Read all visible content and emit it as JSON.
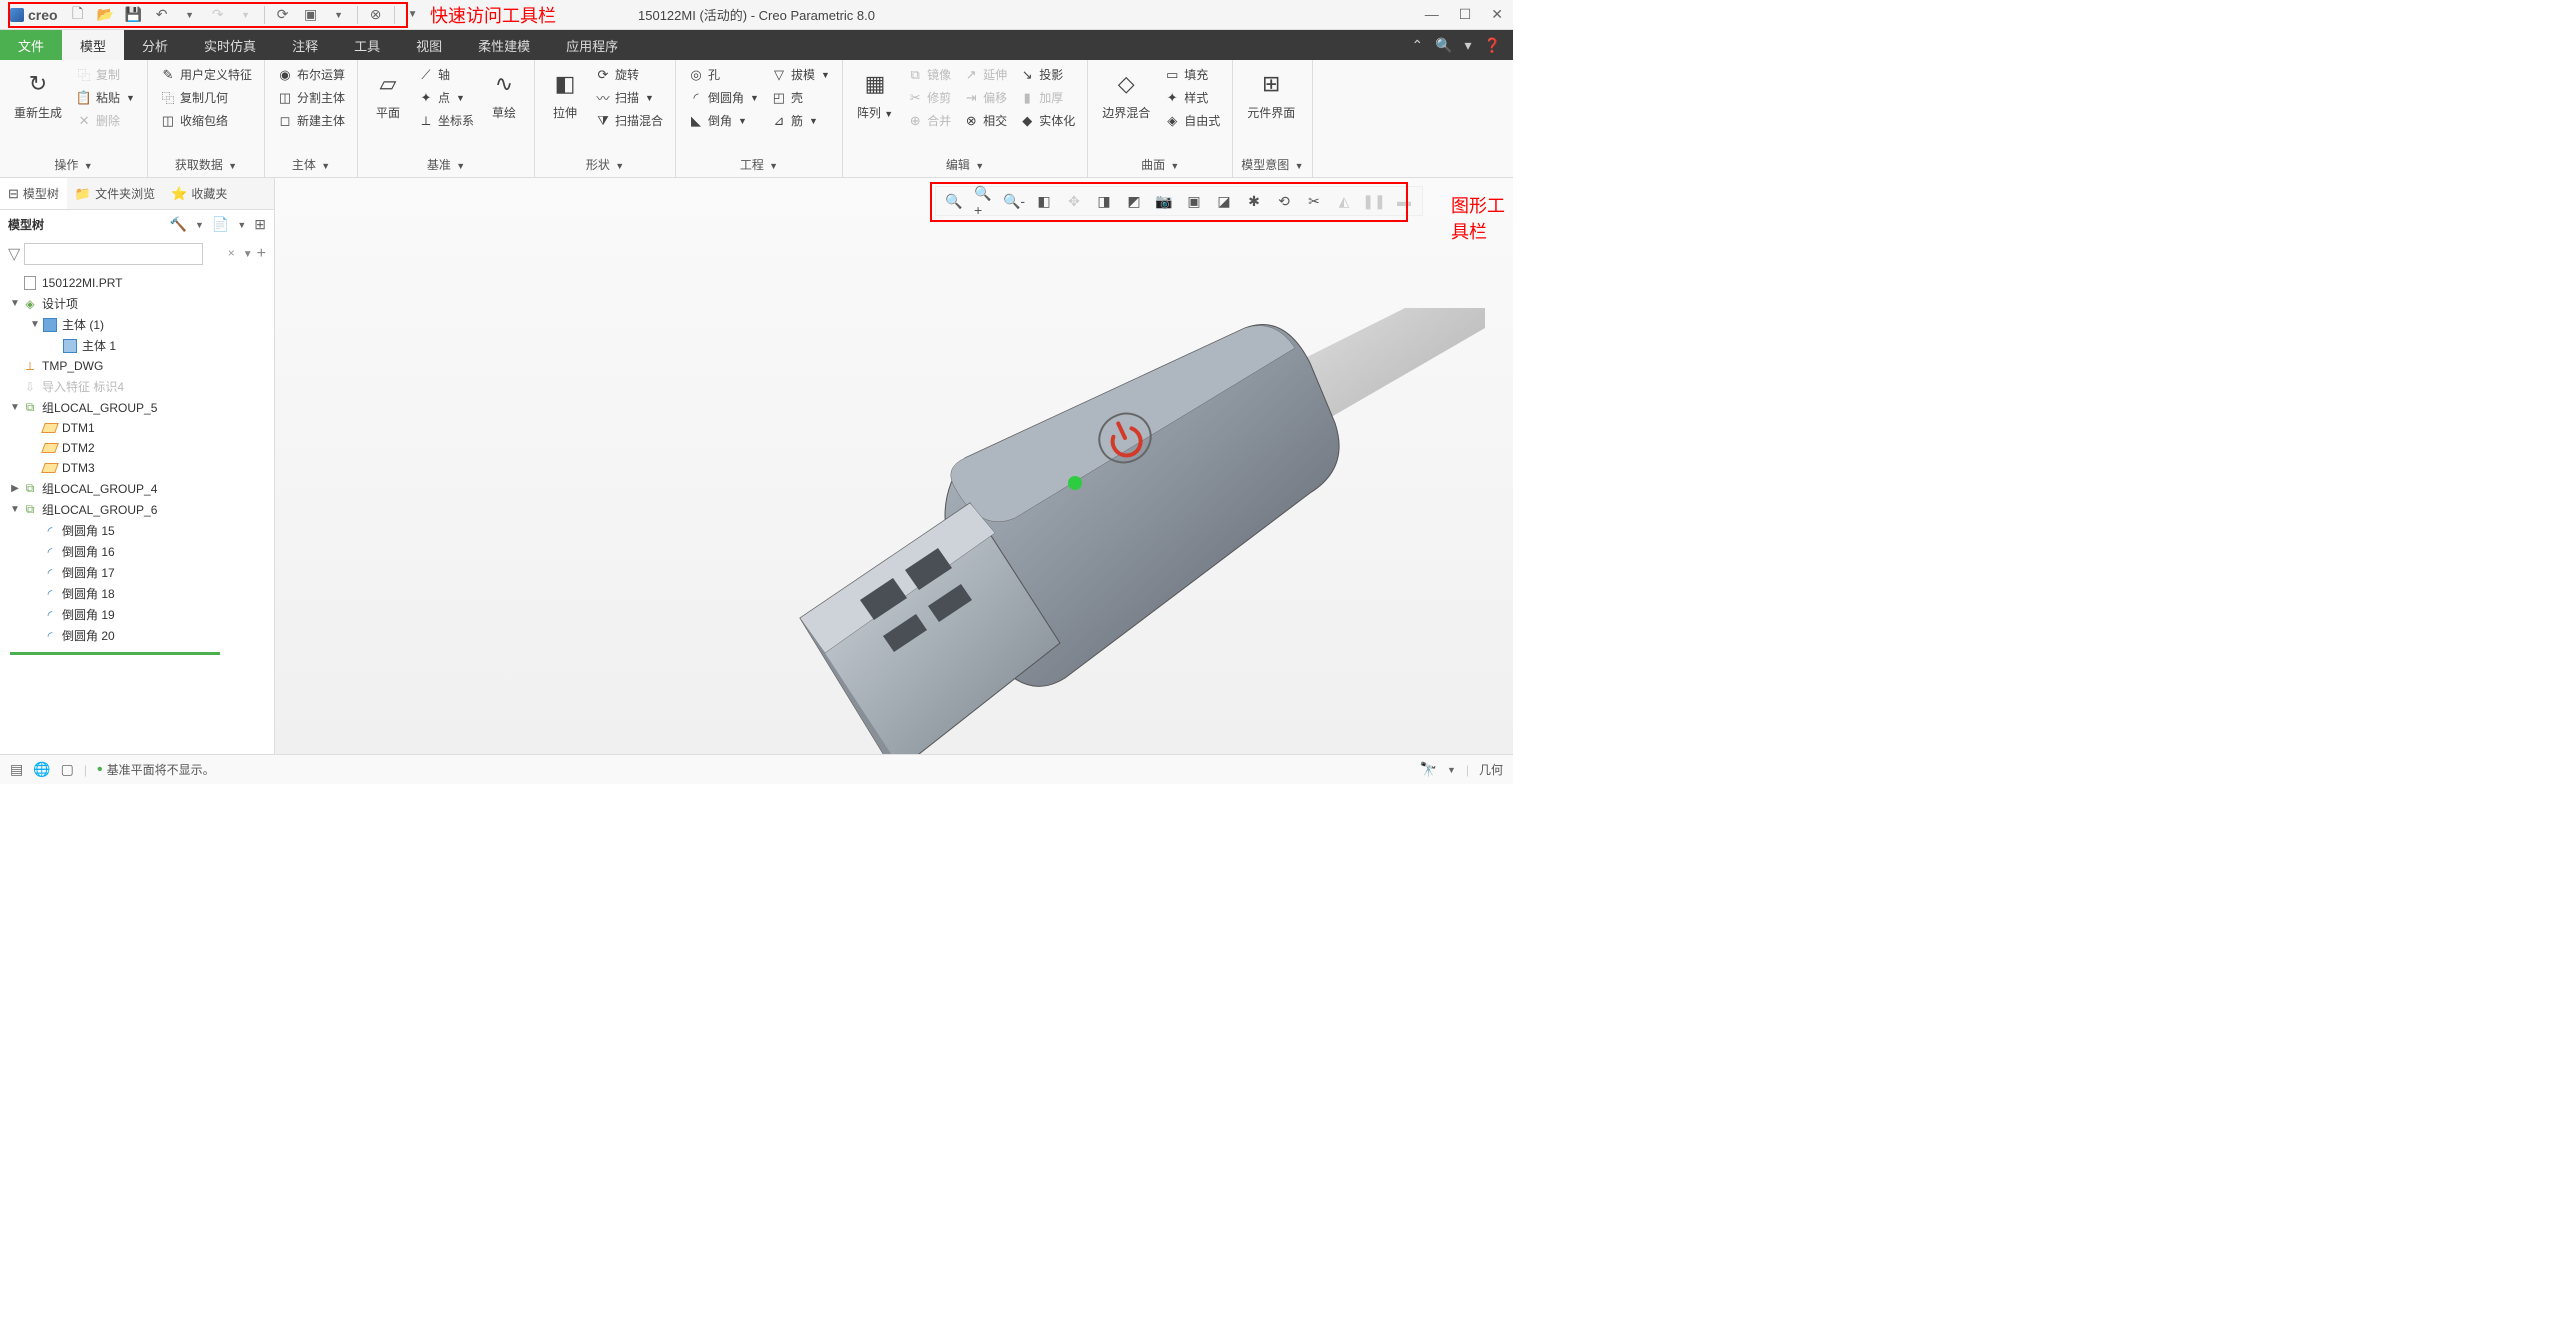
{
  "app": {
    "logo": "creo",
    "title": "150122MI (活动的) - Creo Parametric 8.0"
  },
  "annotations": {
    "qat": "快速访问工具栏",
    "graphics": "图形工具栏"
  },
  "menus": {
    "file": "文件",
    "tabs": [
      "模型",
      "分析",
      "实时仿真",
      "注释",
      "工具",
      "视图",
      "柔性建模",
      "应用程序"
    ]
  },
  "ribbon": {
    "groups": [
      {
        "label": "操作",
        "big": {
          "label": "重新生成",
          "icon": "↻"
        },
        "small": [
          {
            "label": "复制",
            "icon": "⿻",
            "disabled": true
          },
          {
            "label": "粘贴",
            "icon": "📋",
            "dropdown": true
          },
          {
            "label": "删除",
            "icon": "✕",
            "disabled": true
          }
        ]
      },
      {
        "label": "获取数据",
        "small": [
          {
            "label": "用户定义特征",
            "icon": "✎"
          },
          {
            "label": "复制几何",
            "icon": "⿻"
          },
          {
            "label": "收缩包络",
            "icon": "◫"
          }
        ]
      },
      {
        "label": "主体",
        "small": [
          {
            "label": "布尔运算",
            "icon": "◉"
          },
          {
            "label": "分割主体",
            "icon": "◫"
          },
          {
            "label": "新建主体",
            "icon": "◻"
          }
        ]
      },
      {
        "label": "基准",
        "big": {
          "label": "平面",
          "icon": "▱"
        },
        "small": [
          {
            "label": "轴",
            "icon": "⟋"
          },
          {
            "label": "点",
            "icon": "✦",
            "dropdown": true
          },
          {
            "label": "坐标系",
            "icon": "⟂"
          }
        ],
        "big2": {
          "label": "草绘",
          "icon": "∿"
        }
      },
      {
        "label": "形状",
        "big": {
          "label": "拉伸",
          "icon": "◧"
        },
        "small": [
          {
            "label": "旋转",
            "icon": "⟳"
          },
          {
            "label": "扫描",
            "icon": "〰",
            "dropdown": true
          },
          {
            "label": "扫描混合",
            "icon": "⧩"
          }
        ]
      },
      {
        "label": "工程",
        "small_cols": [
          [
            {
              "label": "孔",
              "icon": "◎"
            },
            {
              "label": "倒圆角",
              "icon": "◜",
              "dropdown": true
            },
            {
              "label": "倒角",
              "icon": "◣",
              "dropdown": true
            }
          ],
          [
            {
              "label": "拔模",
              "icon": "▽",
              "dropdown": true
            },
            {
              "label": "壳",
              "icon": "◰"
            },
            {
              "label": "筋",
              "icon": "⊿",
              "dropdown": true
            }
          ]
        ]
      },
      {
        "label": "编辑",
        "big": {
          "label": "阵列",
          "icon": "▦",
          "dropdown": true
        },
        "small_cols": [
          [
            {
              "label": "镜像",
              "icon": "⧉",
              "disabled": true
            },
            {
              "label": "修剪",
              "icon": "✂",
              "disabled": true
            },
            {
              "label": "合并",
              "icon": "⊕",
              "disabled": true
            }
          ],
          [
            {
              "label": "延伸",
              "icon": "↗",
              "disabled": true
            },
            {
              "label": "偏移",
              "icon": "⇥",
              "disabled": true
            },
            {
              "label": "相交",
              "icon": "⊗"
            }
          ],
          [
            {
              "label": "投影",
              "icon": "↘"
            },
            {
              "label": "加厚",
              "icon": "▮",
              "disabled": true
            },
            {
              "label": "实体化",
              "icon": "◆"
            }
          ]
        ]
      },
      {
        "label": "曲面",
        "big": {
          "label": "边界混合",
          "icon": "◇"
        },
        "small": [
          {
            "label": "填充",
            "icon": "▭"
          },
          {
            "label": "样式",
            "icon": "✦"
          },
          {
            "label": "自由式",
            "icon": "◈"
          }
        ]
      },
      {
        "label": "模型意图",
        "big": {
          "label": "元件界面",
          "icon": "⊞"
        }
      }
    ]
  },
  "navigator": {
    "tabs": [
      {
        "label": "模型树",
        "icon": "tree",
        "active": true
      },
      {
        "label": "文件夹浏览",
        "icon": "folder"
      },
      {
        "label": "收藏夹",
        "icon": "star"
      }
    ],
    "title": "模型树",
    "filter_placeholder": "",
    "tree": [
      {
        "depth": 0,
        "tw": "",
        "icon": "part",
        "label": "150122MI.PRT"
      },
      {
        "depth": 0,
        "tw": "▼",
        "icon": "design",
        "label": "设计项"
      },
      {
        "depth": 1,
        "tw": "▼",
        "icon": "bodies",
        "label": "主体 (1)"
      },
      {
        "depth": 2,
        "tw": "",
        "icon": "body",
        "label": "主体 1"
      },
      {
        "depth": 0,
        "tw": "",
        "icon": "csys",
        "label": "TMP_DWG"
      },
      {
        "depth": 0,
        "tw": "",
        "icon": "import",
        "label": "导入特征 标识4",
        "dim": true
      },
      {
        "depth": 0,
        "tw": "▼",
        "icon": "group",
        "label": "组LOCAL_GROUP_5"
      },
      {
        "depth": 1,
        "tw": "",
        "icon": "plane",
        "label": "DTM1"
      },
      {
        "depth": 1,
        "tw": "",
        "icon": "plane",
        "label": "DTM2"
      },
      {
        "depth": 1,
        "tw": "",
        "icon": "plane",
        "label": "DTM3"
      },
      {
        "depth": 0,
        "tw": "▶",
        "icon": "group",
        "label": "组LOCAL_GROUP_4"
      },
      {
        "depth": 0,
        "tw": "▼",
        "icon": "group",
        "label": "组LOCAL_GROUP_6"
      },
      {
        "depth": 1,
        "tw": "",
        "icon": "round",
        "label": "倒圆角 15"
      },
      {
        "depth": 1,
        "tw": "",
        "icon": "round",
        "label": "倒圆角 16"
      },
      {
        "depth": 1,
        "tw": "",
        "icon": "round",
        "label": "倒圆角 17"
      },
      {
        "depth": 1,
        "tw": "",
        "icon": "round",
        "label": "倒圆角 18"
      },
      {
        "depth": 1,
        "tw": "",
        "icon": "round",
        "label": "倒圆角 19"
      },
      {
        "depth": 1,
        "tw": "",
        "icon": "round",
        "label": "倒圆角 20"
      }
    ]
  },
  "status": {
    "message": "基准平面将不显示。",
    "right": "几何"
  }
}
